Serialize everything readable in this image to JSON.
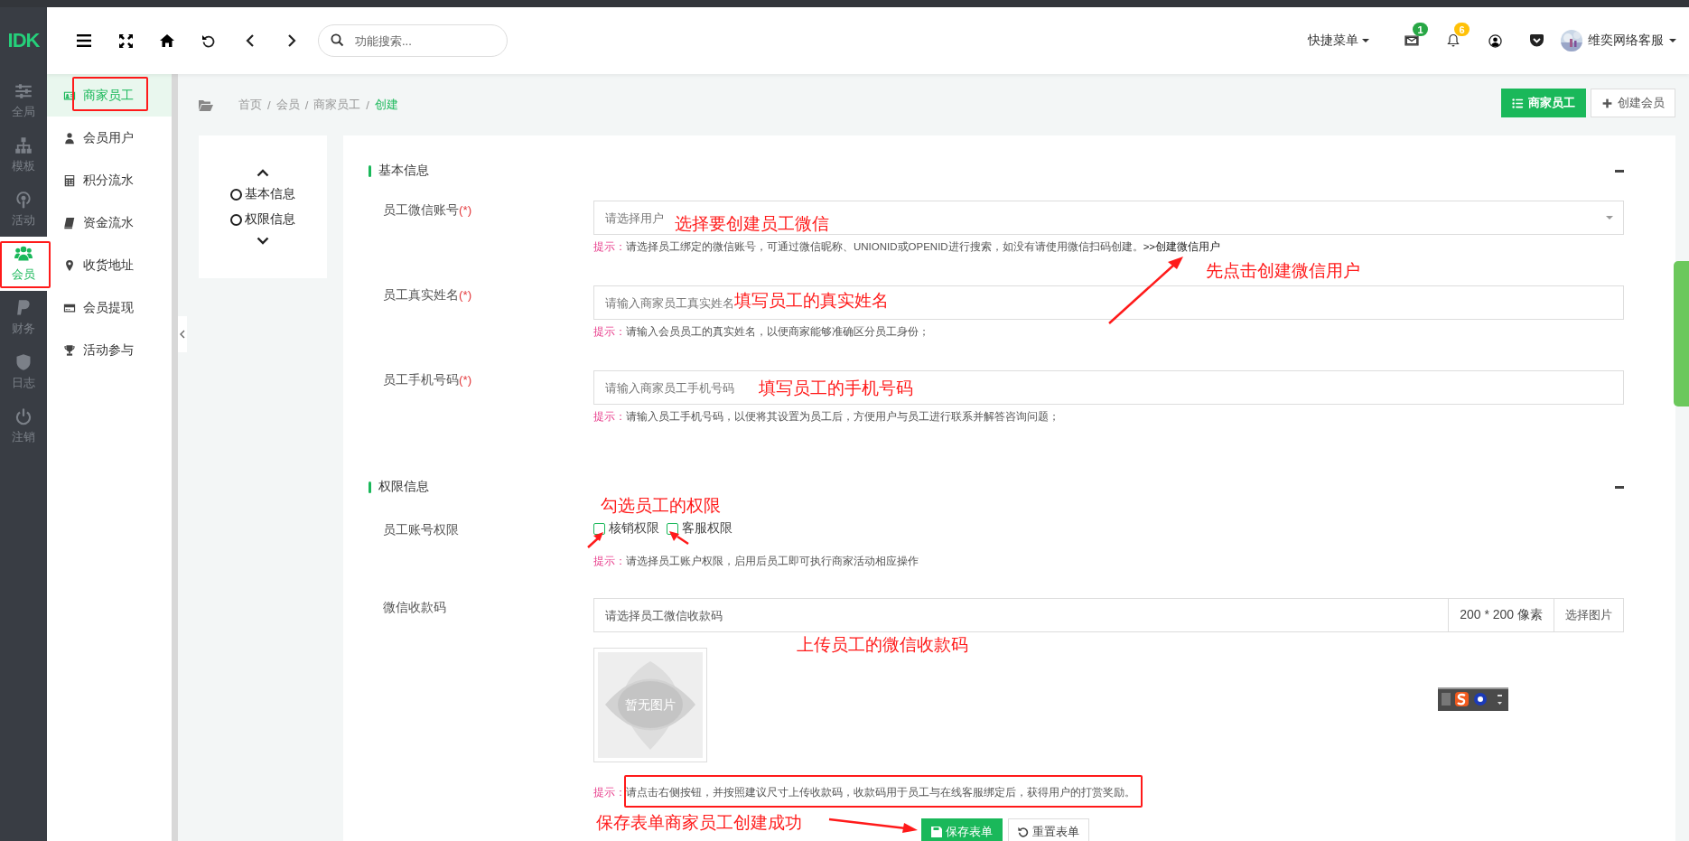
{
  "logo": "IDK",
  "rail": [
    {
      "label": "全局",
      "selected": false
    },
    {
      "label": "模板",
      "selected": false
    },
    {
      "label": "活动",
      "selected": false
    },
    {
      "label": "会员",
      "selected": true
    },
    {
      "label": "财务",
      "selected": false
    },
    {
      "label": "日志",
      "selected": false
    },
    {
      "label": "注销",
      "selected": false
    }
  ],
  "search": {
    "placeholder": "功能搜索..."
  },
  "quick_menu": "快捷菜单",
  "notifications": [
    {
      "badge": "1",
      "color": "#28a745"
    },
    {
      "badge": "6",
      "color": "#ffc107"
    }
  ],
  "user": {
    "name": "维奕网络客服"
  },
  "submenu": [
    {
      "label": "商家员工",
      "selected": true
    },
    {
      "label": "会员用户",
      "selected": false
    },
    {
      "label": "积分流水",
      "selected": false
    },
    {
      "label": "资金流水",
      "selected": false
    },
    {
      "label": "收货地址",
      "selected": false
    },
    {
      "label": "会员提现",
      "selected": false
    },
    {
      "label": "活动参与",
      "selected": false
    }
  ],
  "breadcrumb_separator": "/",
  "breadcrumb": [
    {
      "label": "首页",
      "current": false
    },
    {
      "label": "会员",
      "current": false
    },
    {
      "label": "商家员工",
      "current": false
    },
    {
      "label": "创建",
      "current": true
    }
  ],
  "page_buttons": [
    {
      "label": "商家员工",
      "kind": "primary"
    },
    {
      "label": "创建会员",
      "kind": "default"
    }
  ],
  "anchor_nav": [
    "基本信息",
    "权限信息"
  ],
  "sections": [
    {
      "title": "基本信息",
      "fields": [
        {
          "kind": "select",
          "label": "员工微信账号",
          "required": "(*)",
          "placeholder": "请选择用户",
          "hint_label": "提示：",
          "hint": "请选择员工绑定的微信账号，可通过微信昵称、UNIONID或OPENID进行搜索，如没有请使用微信扫码创建。",
          "link": ">>创建微信用户"
        },
        {
          "kind": "text",
          "label": "员工真实姓名",
          "required": "(*)",
          "placeholder": "请输入商家员工真实姓名",
          "hint_label": "提示：",
          "hint": "请输入会员员工的真实姓名，以便商家能够准确区分员工身份；"
        },
        {
          "kind": "text",
          "label": "员工手机号码",
          "required": "(*)",
          "placeholder": "请输入商家员工手机号码",
          "hint_label": "提示：",
          "hint": "请输入员工手机号码，以便将其设置为员工后，方便用户与员工进行联系并解答咨询问题；"
        }
      ]
    },
    {
      "title": "权限信息",
      "fields": [
        {
          "kind": "checkboxes",
          "label": "员工账号权限",
          "options": [
            {
              "label": "核销权限",
              "checked": false
            },
            {
              "label": "客服权限",
              "checked": false
            }
          ],
          "hint_label": "提示：",
          "hint": "请选择员工账户权限，启用后员工即可执行商家活动相应操作"
        },
        {
          "kind": "upload",
          "label": "微信收款码",
          "placeholder": "请选择员工微信收款码",
          "size": "200 * 200 像素",
          "button": "选择图片",
          "preview": "暂无图片",
          "hint_label": "提示：",
          "hint": "请点击右侧按钮，并按照建议尺寸上传收款码，收款码用于员工与在线客服绑定后，获得用户的打赏奖励。"
        }
      ]
    }
  ],
  "actions": [
    {
      "label": "保存表单",
      "kind": "primary"
    },
    {
      "label": "重置表单",
      "kind": "default"
    }
  ],
  "annotations": [
    {
      "text": "选择要创建员工微信"
    },
    {
      "text": "先点击创建微信用户"
    },
    {
      "text": "填写员工的真实姓名"
    },
    {
      "text": "填写员工的手机号码"
    },
    {
      "text": "勾选员工的权限"
    },
    {
      "text": "上传员工的微信收款码"
    },
    {
      "text": "保存表单商家员工创建成功"
    }
  ]
}
